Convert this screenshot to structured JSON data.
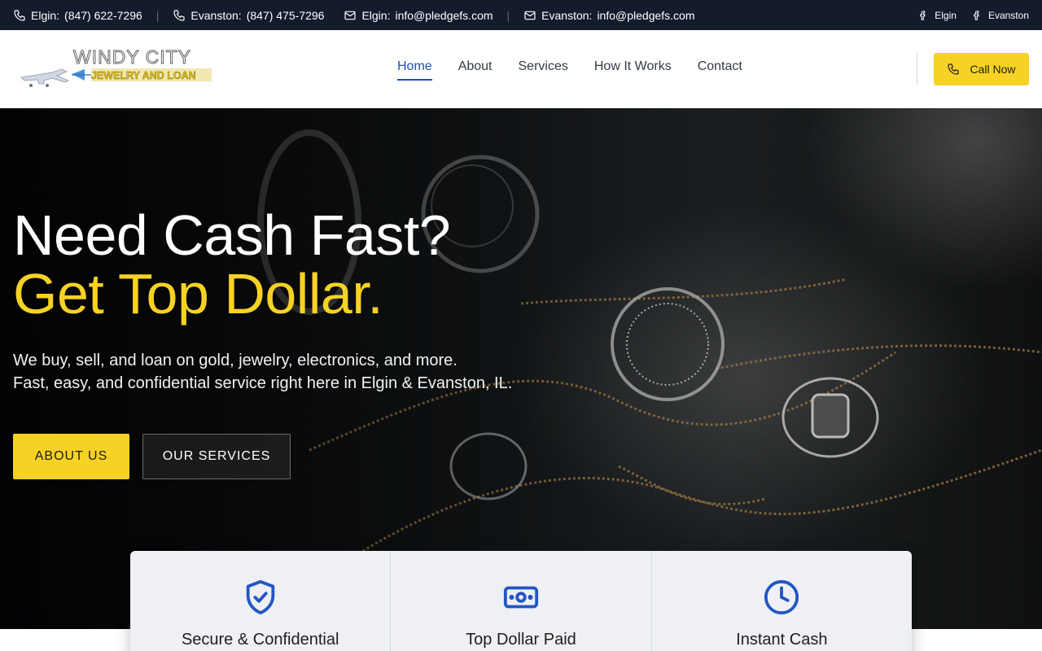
{
  "topbar": {
    "contacts": [
      {
        "icon": "phone-icon",
        "label": "Elgin:",
        "value": "(847) 622-7296"
      },
      {
        "icon": "phone-icon",
        "label": "Evanston:",
        "value": "(847) 475-7296"
      },
      {
        "icon": "mail-icon",
        "label": "Elgin:",
        "value": "info@pledgefs.com"
      },
      {
        "icon": "mail-icon",
        "label": "Evanston:",
        "value": "info@pledgefs.com"
      }
    ],
    "separator": "|",
    "social": [
      {
        "icon": "facebook-icon",
        "label": "Elgin"
      },
      {
        "icon": "facebook-icon",
        "label": "Evanston"
      }
    ]
  },
  "header": {
    "logo": {
      "line1": "WINDY CITY",
      "line2": "JEWELRY AND LOAN"
    },
    "nav": [
      {
        "label": "Home",
        "active": true
      },
      {
        "label": "About",
        "active": false
      },
      {
        "label": "Services",
        "active": false
      },
      {
        "label": "How It Works",
        "active": false
      },
      {
        "label": "Contact",
        "active": false
      }
    ],
    "call_button": {
      "icon": "phone-icon",
      "label": "Call Now"
    }
  },
  "hero": {
    "title_line1": "Need Cash Fast?",
    "title_line2": "Get Top Dollar.",
    "subtitle_line1": "We buy, sell, and loan on gold, jewelry, electronics, and more.",
    "subtitle_line2": "Fast, easy, and confidential service right here in Elgin & Evanston, IL.",
    "buttons": {
      "about": "ABOUT US",
      "services": "OUR SERVICES"
    }
  },
  "features": [
    {
      "icon": "shield-check-icon",
      "title": "Secure & Confidential"
    },
    {
      "icon": "cash-icon",
      "title": "Top Dollar Paid"
    },
    {
      "icon": "clock-icon",
      "title": "Instant Cash"
    }
  ],
  "colors": {
    "topbar_bg": "#141b2d",
    "accent_yellow": "#f6d224",
    "nav_active": "#1e4fb8",
    "icon_blue": "#2356c4"
  }
}
